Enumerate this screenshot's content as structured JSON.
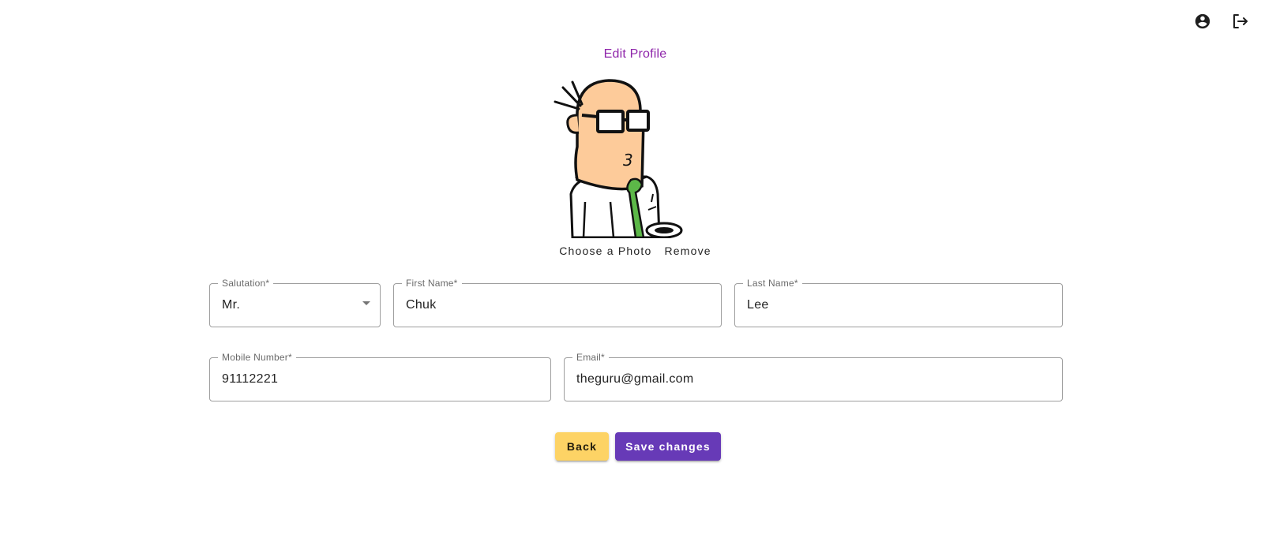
{
  "header": {
    "account_icon": "account-circle-icon",
    "logout_icon": "logout-icon"
  },
  "page": {
    "title": "Edit Profile"
  },
  "photo": {
    "choose_label": "Choose a Photo",
    "remove_label": "Remove"
  },
  "form": {
    "salutation": {
      "label": "Salutation*",
      "value": "Mr."
    },
    "first_name": {
      "label": "First Name*",
      "value": "Chuk"
    },
    "last_name": {
      "label": "Last Name*",
      "value": "Lee"
    },
    "mobile": {
      "label": "Mobile Number*",
      "value": "91112221"
    },
    "email": {
      "label": "Email*",
      "value": "theguru@gmail.com"
    }
  },
  "actions": {
    "back_label": "Back",
    "save_label": "Save changes"
  },
  "colors": {
    "title": "#8e24aa",
    "back_button": "#fdd365",
    "save_button": "#673ab7"
  }
}
